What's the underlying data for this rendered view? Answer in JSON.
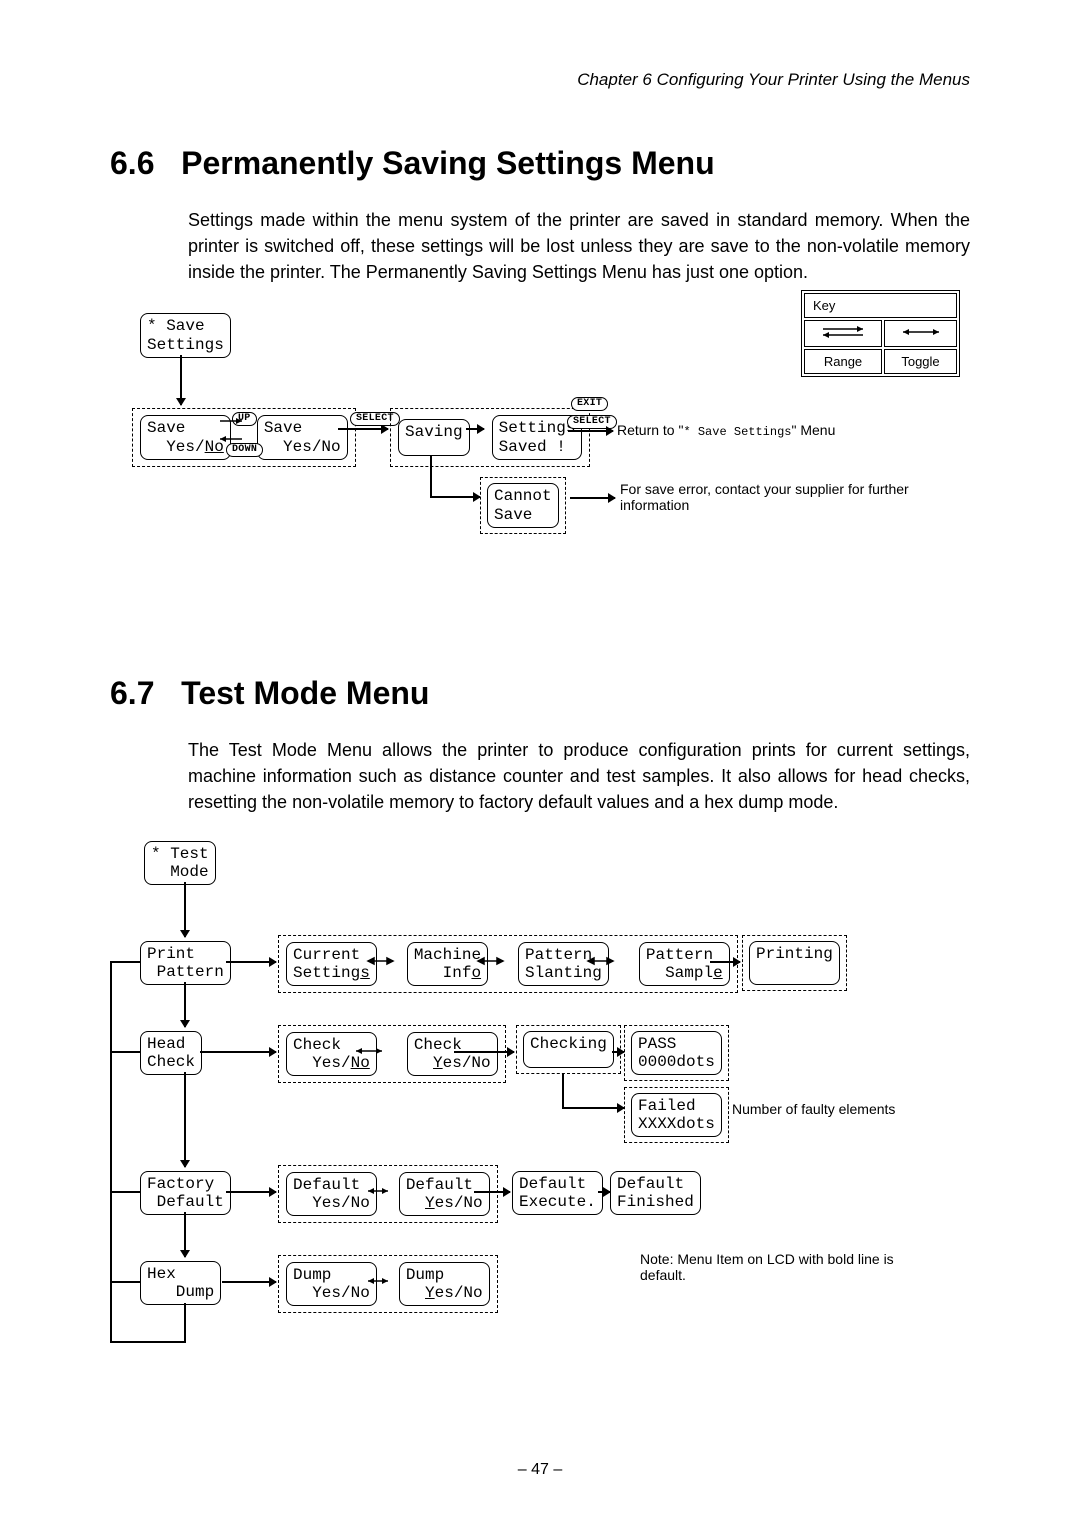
{
  "header": "Chapter 6   Configuring Your Printer Using the Menus",
  "section1": {
    "num": "6.6",
    "title": "Permanently Saving Settings Menu",
    "para": "Settings made within the menu system of the printer are saved in standard memory. When the printer is switched off, these settings will be lost unless they are save to the non-volatile memory inside the printer.    The Permanently Saving Settings Menu has just one option."
  },
  "dia1": {
    "start": "* Save\nSettings",
    "save1a": "Save",
    "save1b": "  Yes/",
    "save1c": "No",
    "save2a": "Save",
    "save2b": "  Yes/No",
    "saving": "Saving",
    "settings_saved": "Settings\nSaved !",
    "cannot": "Cannot\nSave",
    "ret": "Return to \"",
    "ret_mono": "* Save Settings",
    "ret2": "\" Menu",
    "err": "For save error, contact your supplier for further information",
    "key_title": "Key",
    "key_range": "Range",
    "key_toggle": "Toggle",
    "pill_up": "UP",
    "pill_down": "DOWN",
    "pill_select": "SELECT",
    "pill_exit": "EXIT"
  },
  "section2": {
    "num": "6.7",
    "title": "Test Mode Menu",
    "para": "The Test Mode Menu allows the printer to produce configuration prints for current settings, machine information such as distance counter and test samples. It also allows for head checks, resetting the non-volatile memory to factory default values and a hex dump mode."
  },
  "dia2": {
    "start": "* Test\n  Mode",
    "r1_a": "Print\n Pattern",
    "r1_b": "Current\nSettings",
    "r1_c": "Machine\n   Info",
    "r1_d": "Pattern\nSlanting",
    "r1_e": "Pattern\n  Sample",
    "r1_f": "Printing\n ",
    "r2_a": "Head\nCheck",
    "r2_b1": "Check",
    "r2_b2": "  Yes/",
    "r2_b3": "No",
    "r2_c1": "Check",
    "r2_c2": "  ",
    "r2_c3": "Y",
    "r2_c4": "es/No",
    "r2_d": "Checking",
    "r2_e": "PASS\n0000dots",
    "r2_f": "Failed\nXXXXdots",
    "r2_note": "Number of faulty elements",
    "r3_a": "Factory\n Default",
    "r3_b": "Default\n  Yes/No",
    "r3_c1": "Default",
    "r3_c2": "  ",
    "r3_c3": "Y",
    "r3_c4": "es/No",
    "r3_d": "Default\nExecute.",
    "r3_e": "Default\nFinished",
    "r4_a": "Hex\n   Dump",
    "r4_b": "Dump\n  Yes/No",
    "r4_c1": "Dump",
    "r4_c2": "  ",
    "r4_c3": "Y",
    "r4_c4": "es/No",
    "note": "Note: Menu Item on LCD with bold line is default."
  },
  "pagenum": "47"
}
